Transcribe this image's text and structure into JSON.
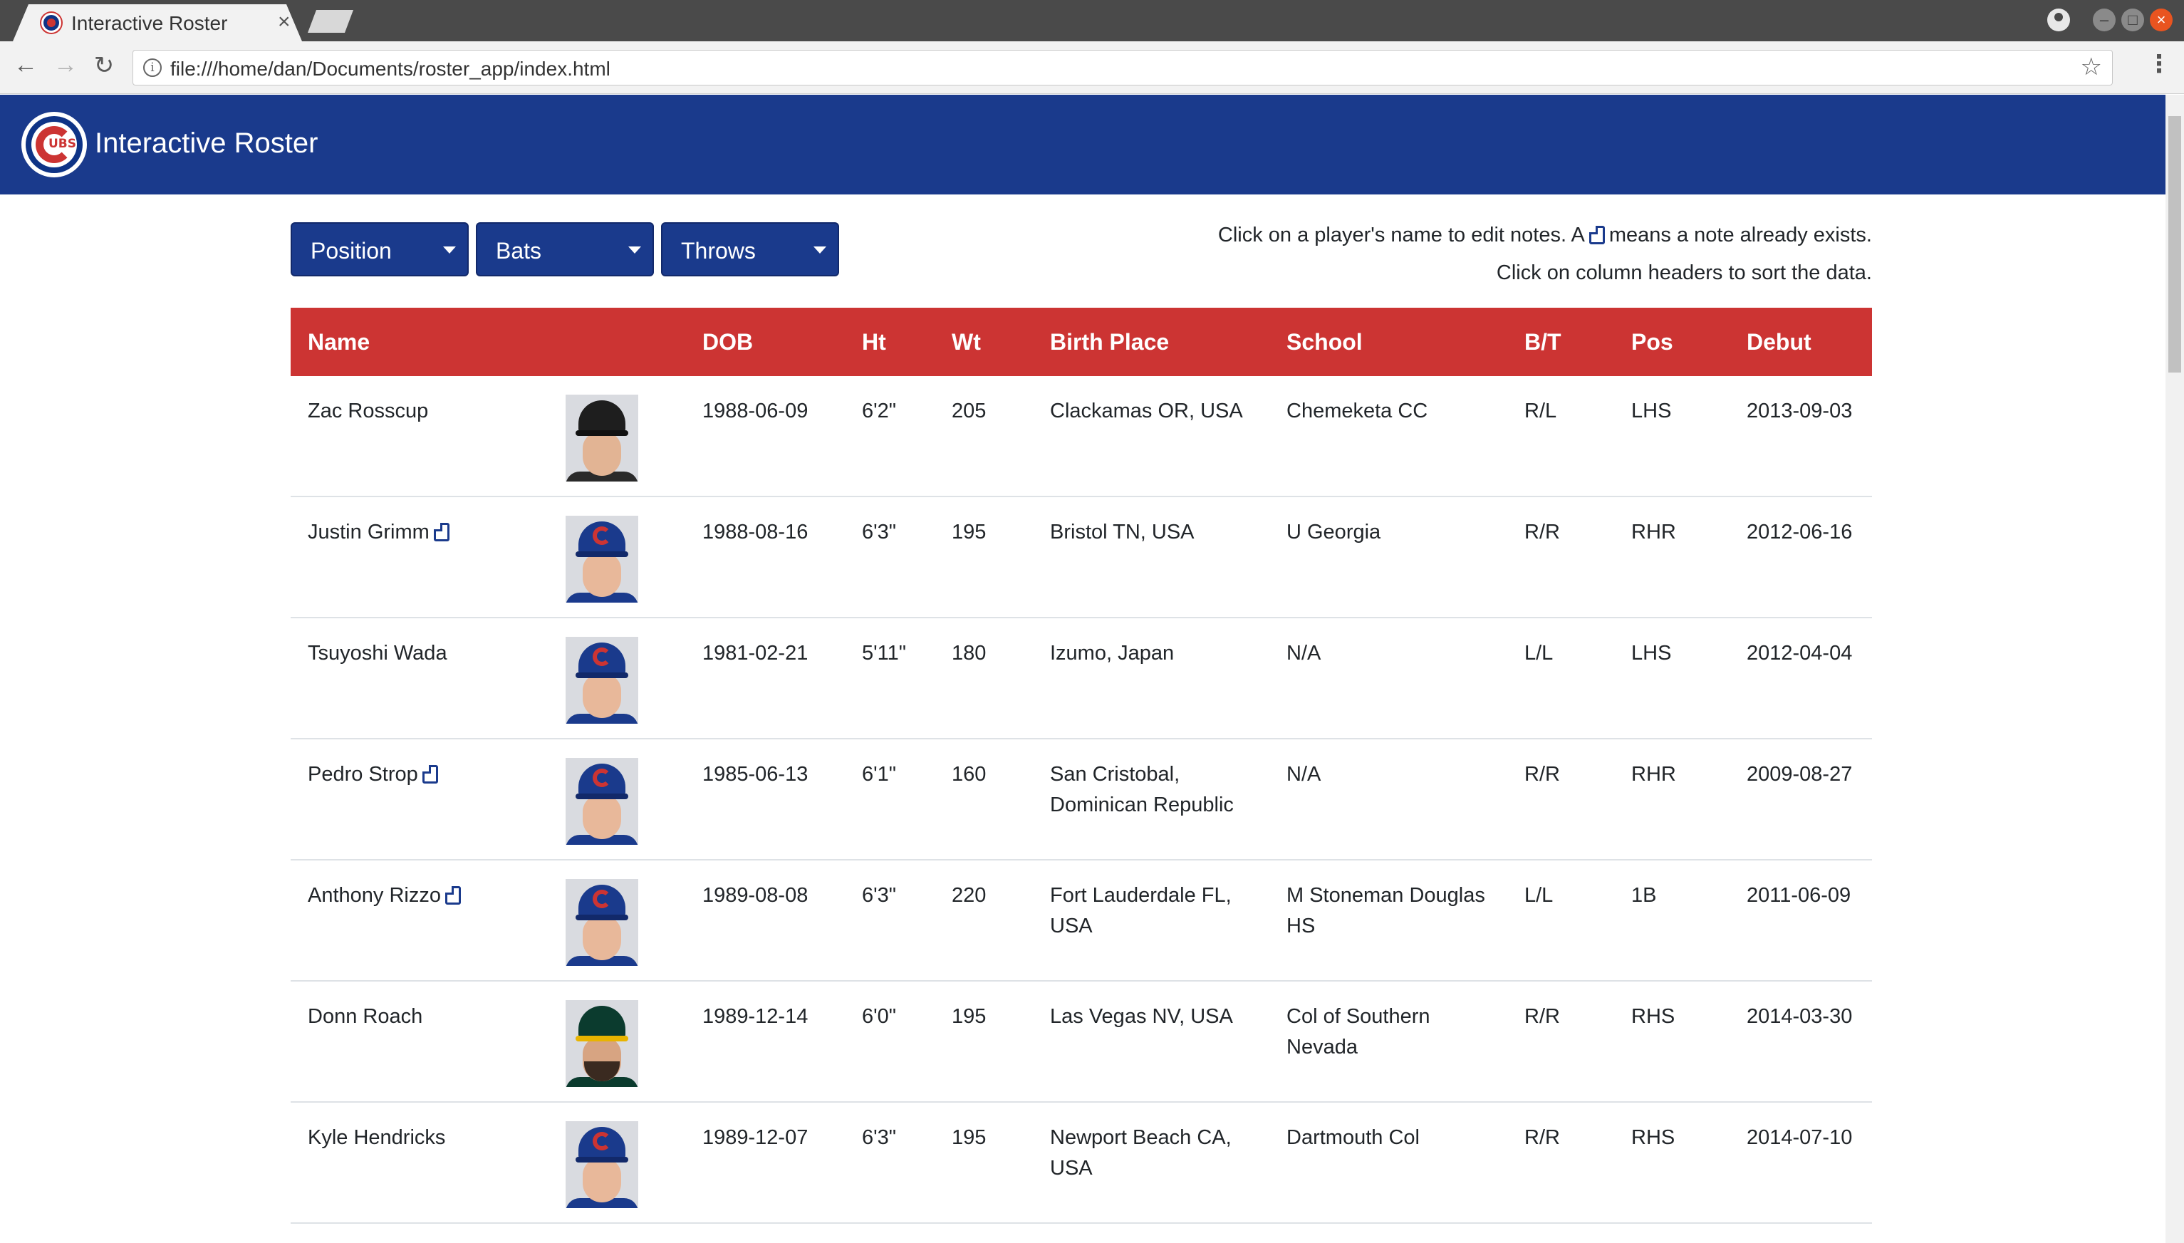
{
  "browser": {
    "tab_title": "Interactive Roster",
    "tab_close": "×",
    "url": "file:///home/dan/Documents/roster_app/index.html",
    "back_icon": "←",
    "forward_icon": "→",
    "reload_icon": "↻",
    "info_icon": "i",
    "star_icon": "☆",
    "menu_icon": "⋮",
    "min_icon": "–",
    "max_icon": "□",
    "close_icon": "×"
  },
  "app": {
    "title": "Interactive Roster",
    "colors": {
      "navy": "#1a3a8c",
      "red": "#cc3433"
    }
  },
  "filters": [
    {
      "label": "Position"
    },
    {
      "label": "Bats"
    },
    {
      "label": "Throws"
    }
  ],
  "help": {
    "line1_before": "Click on a player's name to edit notes. A",
    "line1_after": "means a note already exists.",
    "line2": "Click on column headers to sort the data."
  },
  "table": {
    "headers": [
      "Name",
      "DOB",
      "Ht",
      "Wt",
      "Birth Place",
      "School",
      "B/T",
      "Pos",
      "Debut"
    ],
    "rows": [
      {
        "name": "Zac Rosscup",
        "has_note": false,
        "team_cap": "rockies",
        "dob": "1988-06-09",
        "ht": "6'2\"",
        "wt": "205",
        "birth_place": [
          "Clackamas OR, USA"
        ],
        "school": [
          "Chemeketa CC"
        ],
        "bt": "R/L",
        "pos": "LHS",
        "debut": "2013-09-03"
      },
      {
        "name": "Justin Grimm",
        "has_note": true,
        "team_cap": "cubs",
        "dob": "1988-08-16",
        "ht": "6'3\"",
        "wt": "195",
        "birth_place": [
          "Bristol TN, USA"
        ],
        "school": [
          "U Georgia"
        ],
        "bt": "R/R",
        "pos": "RHR",
        "debut": "2012-06-16"
      },
      {
        "name": "Tsuyoshi Wada",
        "has_note": false,
        "team_cap": "cubs",
        "dob": "1981-02-21",
        "ht": "5'11\"",
        "wt": "180",
        "birth_place": [
          "Izumo, Japan"
        ],
        "school": [
          "N/A"
        ],
        "bt": "L/L",
        "pos": "LHS",
        "debut": "2012-04-04"
      },
      {
        "name": "Pedro Strop",
        "has_note": true,
        "team_cap": "cubs",
        "dob": "1985-06-13",
        "ht": "6'1\"",
        "wt": "160",
        "birth_place": [
          "San Cristobal,",
          "Dominican Republic"
        ],
        "school": [
          "N/A"
        ],
        "bt": "R/R",
        "pos": "RHR",
        "debut": "2009-08-27"
      },
      {
        "name": "Anthony Rizzo",
        "has_note": true,
        "team_cap": "cubs",
        "dob": "1989-08-08",
        "ht": "6'3\"",
        "wt": "220",
        "birth_place": [
          "Fort Lauderdale FL,",
          "USA"
        ],
        "school": [
          "M Stoneman Douglas",
          "HS"
        ],
        "bt": "L/L",
        "pos": "1B",
        "debut": "2011-06-09"
      },
      {
        "name": "Donn Roach",
        "has_note": false,
        "team_cap": "athletics",
        "dob": "1989-12-14",
        "ht": "6'0\"",
        "wt": "195",
        "birth_place": [
          "Las Vegas NV, USA"
        ],
        "school": [
          "Col of Southern",
          "Nevada"
        ],
        "bt": "R/R",
        "pos": "RHS",
        "debut": "2014-03-30"
      },
      {
        "name": "Kyle Hendricks",
        "has_note": false,
        "team_cap": "cubs",
        "dob": "1989-12-07",
        "ht": "6'3\"",
        "wt": "195",
        "birth_place": [
          "Newport Beach CA,",
          "USA"
        ],
        "school": [
          "Dartmouth Col"
        ],
        "bt": "R/R",
        "pos": "RHS",
        "debut": "2014-07-10"
      }
    ]
  }
}
